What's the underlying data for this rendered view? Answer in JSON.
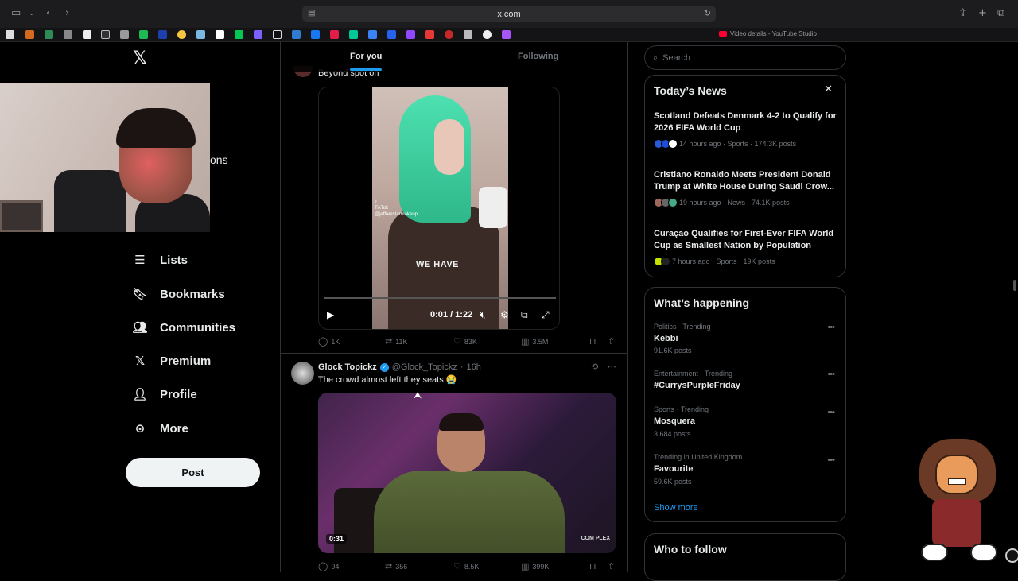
{
  "browser": {
    "url": "x.com",
    "tab_title": "Video details - YouTube Studio"
  },
  "sidebar": {
    "partial_label": "ons",
    "items": [
      {
        "label": "Lists",
        "icon": "list-icon"
      },
      {
        "label": "Bookmarks",
        "icon": "bookmark-icon"
      },
      {
        "label": "Communities",
        "icon": "communities-icon"
      },
      {
        "label": "Premium",
        "icon": "x-icon"
      },
      {
        "label": "Profile",
        "icon": "person-icon"
      },
      {
        "label": "More",
        "icon": "more-circle-icon"
      }
    ],
    "post_button": "Post"
  },
  "feed": {
    "tabs": [
      {
        "label": "For you",
        "active": true
      },
      {
        "label": "Following",
        "active": false
      }
    ],
    "prev_text": "Beyond spot on",
    "video1": {
      "overlay_text": "WE HAVE",
      "tiktok_label": "TikTok",
      "tiktok_handle": "@jeffreestarmakeup",
      "time": "0:01 / 1:22"
    },
    "tweet1_actions": {
      "replies": "1K",
      "reposts": "11K",
      "likes": "83K",
      "views": "3.5M"
    },
    "tweet2": {
      "name": "Glock Topickz",
      "handle": "@Glock_Topickz",
      "age": "16h",
      "text": "The crowd almost left they seats 😭",
      "video_duration": "0:31",
      "video_logo": "COM PLEX",
      "actions": {
        "replies": "94",
        "reposts": "356",
        "likes": "8.5K",
        "views": "399K"
      }
    }
  },
  "right": {
    "search_placeholder": "Search",
    "news": {
      "title": "Today’s News",
      "items": [
        {
          "title": "Scotland Defeats Denmark 4-2 to Qualify for 2026 FIFA World Cup",
          "meta": "14 hours ago · Sports · 174.3K posts"
        },
        {
          "title": "Cristiano Ronaldo Meets President Donald Trump at White House During Saudi Crow...",
          "meta": "19 hours ago · News · 74.1K posts"
        },
        {
          "title": "Curaçao Qualifies for First-Ever FIFA World Cup as Smallest Nation by Population",
          "meta": "7 hours ago · Sports · 19K posts"
        }
      ]
    },
    "happening": {
      "title": "What’s happening",
      "items": [
        {
          "category": "Politics · Trending",
          "name": "Kebbi",
          "count": "91.6K posts"
        },
        {
          "category": "Entertainment · Trending",
          "name": "#CurrysPurpleFriday",
          "count": ""
        },
        {
          "category": "Sports · Trending",
          "name": "Mosquera",
          "count": "3,684 posts"
        },
        {
          "category": "Trending in United Kingdom",
          "name": "Favourite",
          "count": "59.6K posts"
        }
      ],
      "show_more": "Show more"
    },
    "who_to_follow": {
      "title": "Who to follow"
    }
  },
  "colors": {
    "accent": "#1d9bf0",
    "background": "#000000",
    "border": "#2f3336",
    "muted": "#71767b"
  }
}
